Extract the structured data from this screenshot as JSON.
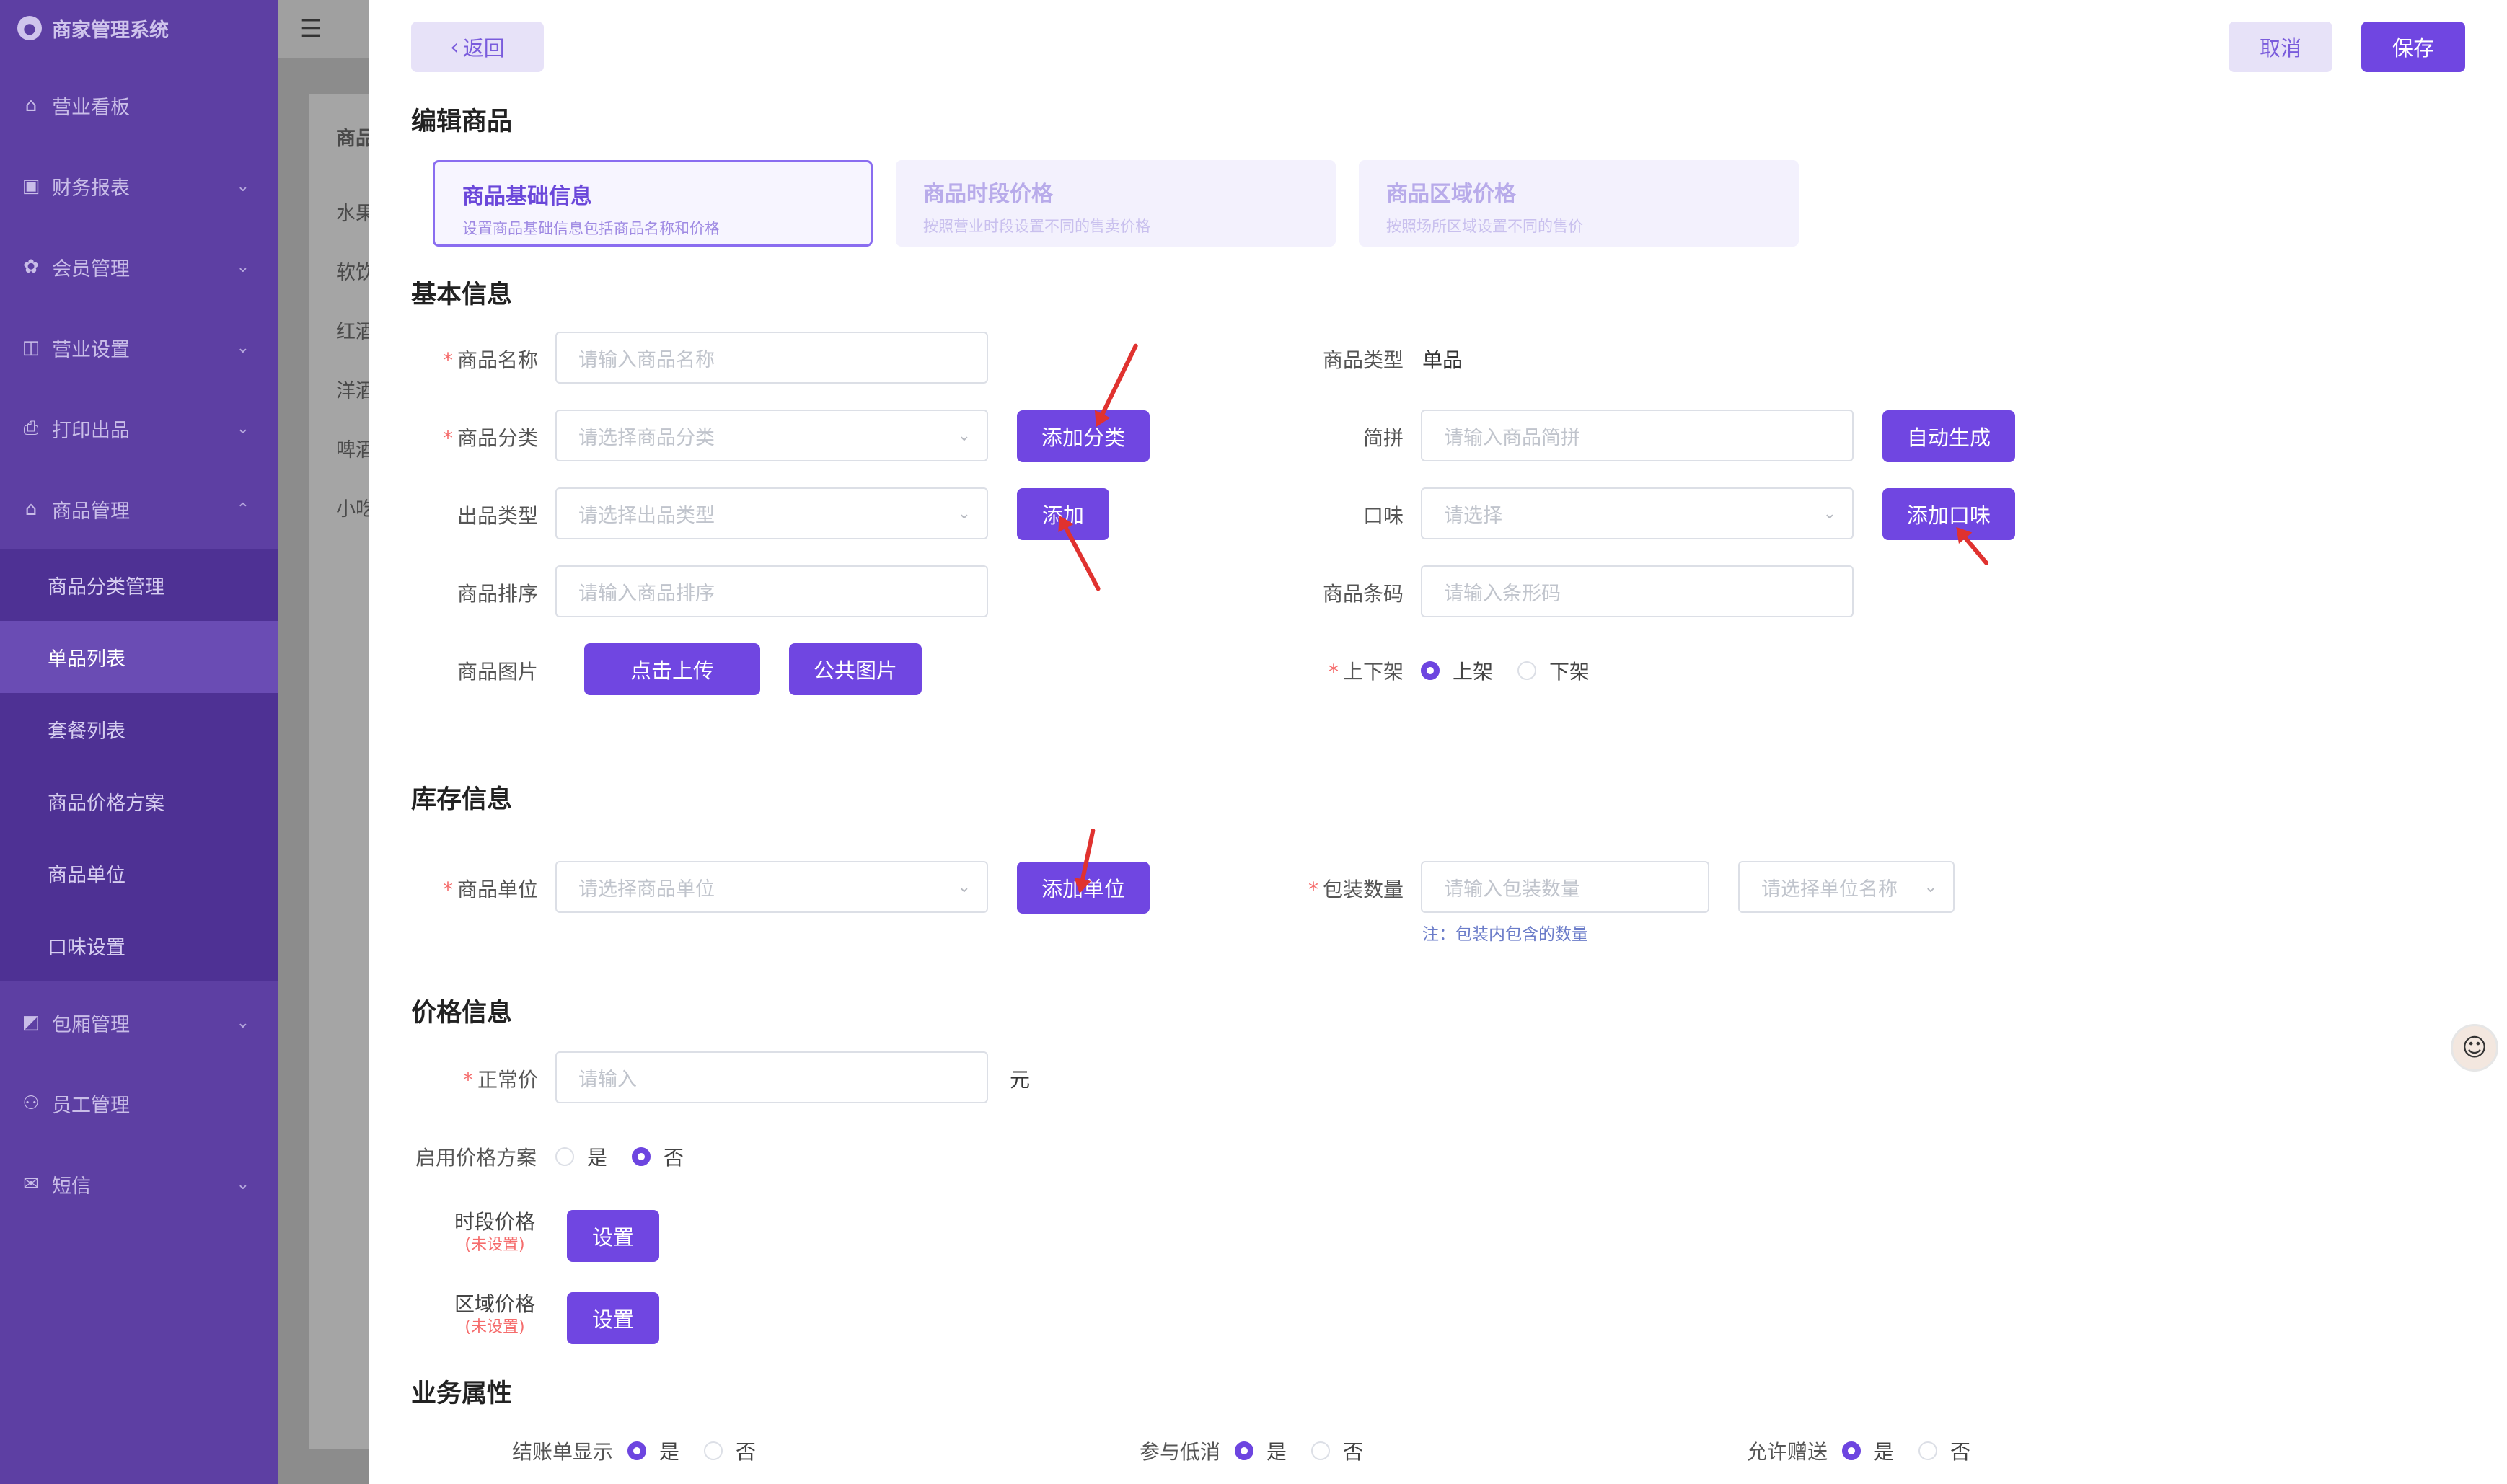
{
  "sidebar": {
    "brand": "商家管理系统",
    "items": [
      {
        "label": "营业看板",
        "icon": "⌂"
      },
      {
        "label": "财务报表",
        "icon": "▣"
      },
      {
        "label": "会员管理",
        "icon": "✿"
      },
      {
        "label": "营业设置",
        "icon": "◫"
      },
      {
        "label": "打印出品",
        "icon": "⎙"
      },
      {
        "label": "商品管理",
        "icon": "⌂"
      }
    ],
    "sub_items": [
      "商品分类管理",
      "单品列表",
      "套餐列表",
      "商品价格方案",
      "商品单位",
      "口味设置"
    ],
    "items_after": [
      {
        "label": "包厢管理",
        "icon": "◩"
      },
      {
        "label": "员工管理",
        "icon": "⚇"
      },
      {
        "label": "短信",
        "icon": "✉"
      }
    ]
  },
  "background": {
    "col_title": "商品",
    "rows": [
      "水果",
      "软饮",
      "红酒",
      "洋酒",
      "啤酒",
      "小吃"
    ]
  },
  "header": {
    "back_label": "返回",
    "cancel_label": "取消",
    "save_label": "保存",
    "page_title": "编辑商品"
  },
  "tabs": [
    {
      "title": "商品基础信息",
      "desc": "设置商品基础信息包括商品名称和价格"
    },
    {
      "title": "商品时段价格",
      "desc": "按照营业时段设置不同的售卖价格"
    },
    {
      "title": "商品区域价格",
      "desc": "按照场所区域设置不同的售价"
    }
  ],
  "basic": {
    "title": "基本信息",
    "name_label": "商品名称",
    "name_placeholder": "请输入商品名称",
    "category_label": "商品分类",
    "category_placeholder": "请选择商品分类",
    "add_category": "添加分类",
    "output_label": "出品类型",
    "output_placeholder": "请选择出品类型",
    "add_label": "添加",
    "sort_label": "商品排序",
    "sort_placeholder": "请输入商品排序",
    "image_label": "商品图片",
    "upload_label": "点击上传",
    "public_image_label": "公共图片",
    "type_label": "商品类型",
    "type_value": "单品",
    "pinyin_label": "简拼",
    "pinyin_placeholder": "请输入商品简拼",
    "auto_label": "自动生成",
    "flavor_label": "口味",
    "flavor_placeholder": "请选择",
    "add_flavor": "添加口味",
    "barcode_label": "商品条码",
    "barcode_placeholder": "请输入条形码",
    "shelf_label": "上下架",
    "shelf_on": "上架",
    "shelf_off": "下架"
  },
  "stock": {
    "title": "库存信息",
    "unit_label": "商品单位",
    "unit_placeholder": "请选择商品单位",
    "add_unit": "添加单位",
    "pack_label": "包装数量",
    "pack_placeholder": "请输入包装数量",
    "pack_unit_placeholder": "请选择单位名称",
    "pack_note": "注：包装内包含的数量"
  },
  "price": {
    "title": "价格信息",
    "normal_label": "正常价",
    "normal_placeholder": "请输入",
    "currency": "元",
    "plan_label": "启用价格方案",
    "yes": "是",
    "no": "否",
    "period_label": "时段价格",
    "period_status": "(未设置)",
    "area_label": "区域价格",
    "area_status": "(未设置)",
    "set_label": "设置"
  },
  "business": {
    "title": "业务属性",
    "checkout_label": "结账单显示",
    "discount_label": "参与低消",
    "gift_label": "允许赠送",
    "yes": "是",
    "no": "否"
  },
  "colors": {
    "primary": "#7046E1",
    "sidebar": "#5D3FA3",
    "annotation": "#E0322F"
  }
}
